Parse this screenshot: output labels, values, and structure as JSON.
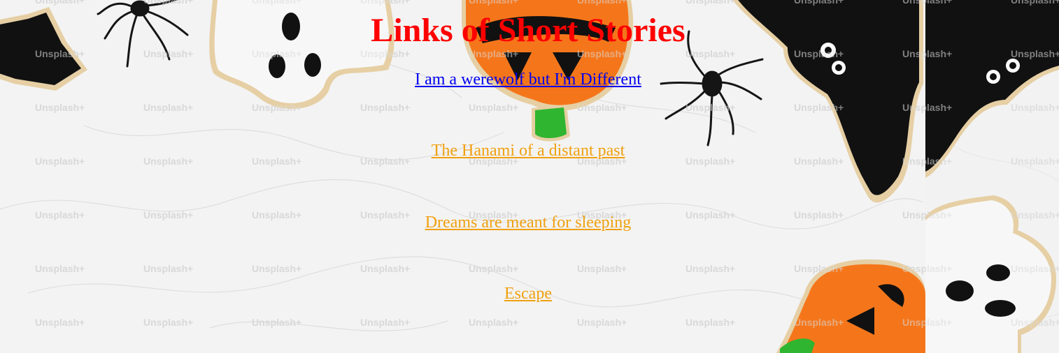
{
  "page": {
    "title": "Links of Short Stories"
  },
  "stories": [
    {
      "label": "I am a werewolf but I'm Different",
      "state": "visited"
    },
    {
      "label": "The Hanami of a distant past",
      "state": "unvisited"
    },
    {
      "label": "Dreams are meant for sleeping",
      "state": "unvisited"
    },
    {
      "label": "Escape",
      "state": "unvisited"
    }
  ],
  "background": {
    "watermark": "Unsplash+",
    "decor": [
      "bat-cookie",
      "ghost-cookie",
      "pumpkin-cookie",
      "spider"
    ]
  },
  "colors": {
    "title": "#ff0000",
    "visited_link": "#0000ee",
    "link": "#f0a010",
    "marble": "#f2f2f2",
    "bat_icing": "#111111",
    "ghost_icing": "#f7f7f7",
    "pumpkin_icing": "#f5761a",
    "stem_icing": "#2fb52f",
    "cookie_edge": "#e6cfa4"
  }
}
